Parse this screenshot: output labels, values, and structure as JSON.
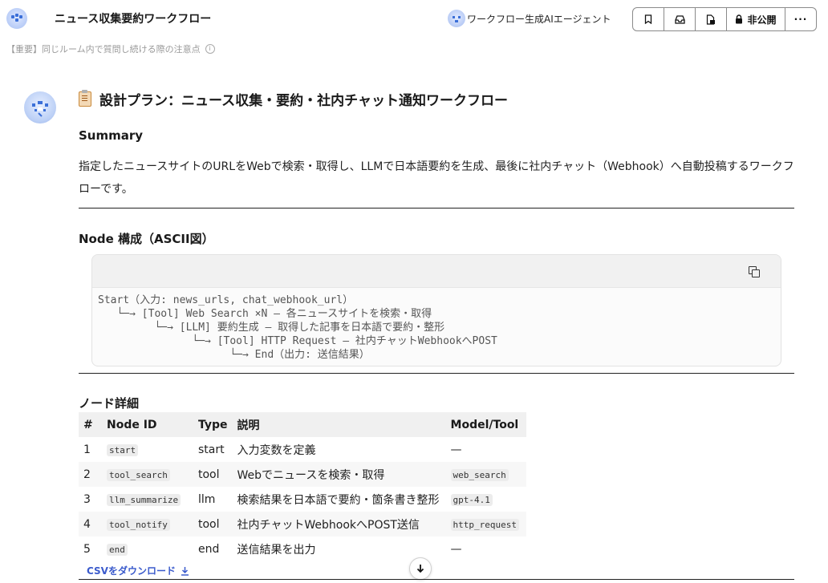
{
  "header": {
    "title": "ニュース収集要約ワークフロー",
    "agent_name": "ワークフロー生成AIエージェント",
    "private_label": "非公開",
    "more_label": "···"
  },
  "notice": "【重要】同じルーム内で質問し続ける際の注意点",
  "message": {
    "plan_title": "設計プラン：ニュース収集・要約・社内チャット通知ワークフロー",
    "summary_heading": "Summary",
    "summary_text": "指定したニュースサイトのURLをWebで検索・取得し、LLMで日本語要約を生成、最後に社内チャット（Webhook）へ自動投稿するワークフローです。",
    "node_heading": "Node 構成（ASCII図）",
    "ascii_lines": [
      "Start（入力: news_urls, chat_webhook_url）",
      "   └─→ [Tool] Web Search ×N – 各ニュースサイトを検索・取得",
      "         └─→ [LLM] 要約生成 – 取得した記事を日本語で要約・整形",
      "               └─→ [Tool] HTTP Request – 社内チャットWebhookへPOST",
      "                     └─→ End（出力: 送信結果）"
    ],
    "detail_heading": "ノード詳細",
    "table": {
      "headers": [
        "#",
        "Node ID",
        "Type",
        "説明",
        "Model/Tool"
      ],
      "rows": [
        [
          "1",
          "start",
          "start",
          "入力変数を定義",
          "—"
        ],
        [
          "2",
          "tool_search",
          "tool",
          "Webでニュースを検索・取得",
          "web_search"
        ],
        [
          "3",
          "llm_summarize",
          "llm",
          "検索結果を日本語で要約・箇条書き整形",
          "gpt-4.1"
        ],
        [
          "4",
          "tool_notify",
          "tool",
          "社内チャットWebhookへPOST送信",
          "http_request"
        ],
        [
          "5",
          "end",
          "end",
          "送信結果を出力",
          "—"
        ]
      ]
    },
    "csv_label": "CSVをダウンロード"
  },
  "icons": {
    "bookmark": "bookmark-icon",
    "inbox": "inbox-icon",
    "doc_lock": "document-icon",
    "lock": "lock-icon",
    "copy": "copy-icon",
    "download": "download-icon",
    "scroll_down": "arrow-down-icon"
  }
}
